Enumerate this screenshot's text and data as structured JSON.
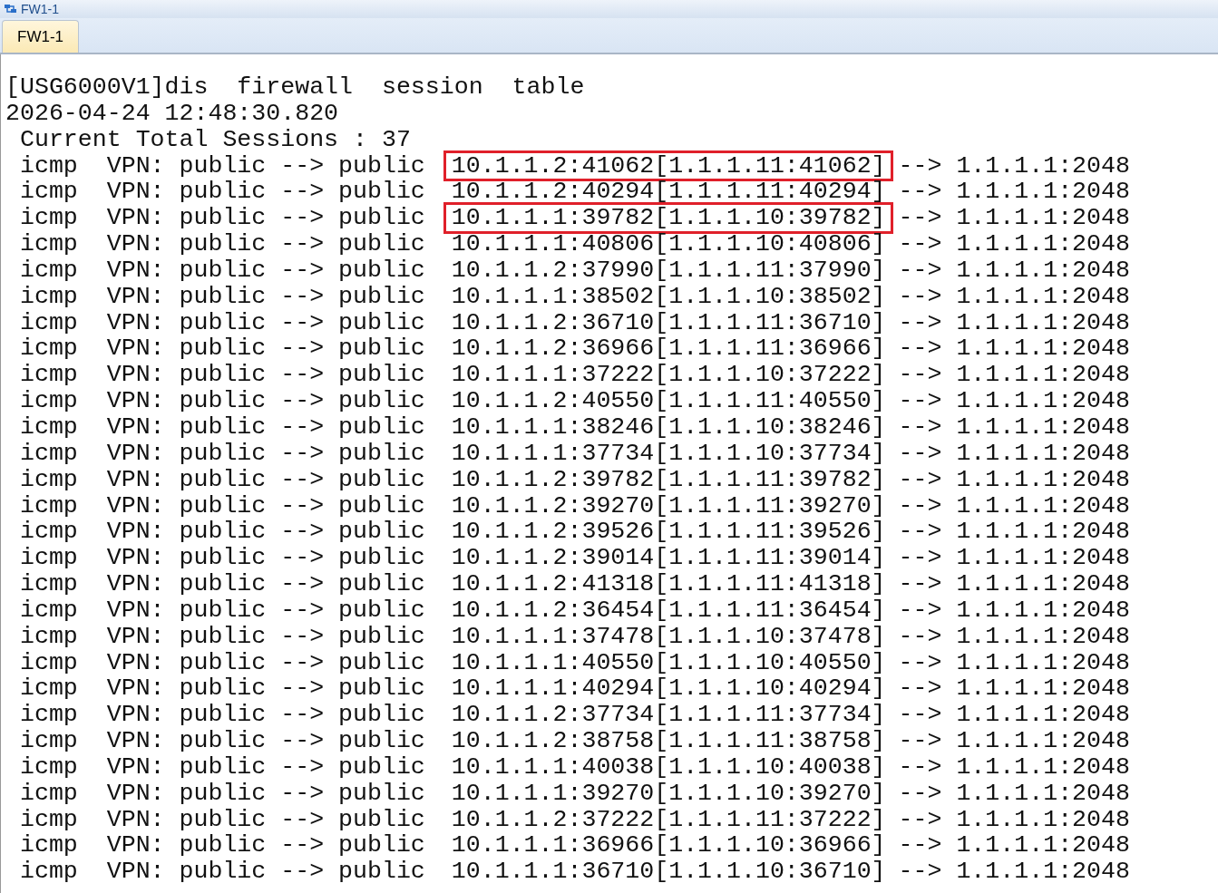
{
  "window": {
    "title": "FW1-1"
  },
  "tabs": [
    {
      "label": "FW1-1",
      "selected": true
    }
  ],
  "terminal": {
    "lines": [
      {
        "kind": "text",
        "text": "[USG6000V1]dis  firewall  session  table"
      },
      {
        "kind": "text",
        "text": "2026-04-24 12:48:30.820"
      },
      {
        "kind": "text",
        "text": " Current Total Sessions : 37"
      },
      {
        "kind": "session",
        "head": " icmp  VPN: public --> public",
        "source": "10.1.1.2:41062[1.1.1.11:41062]",
        "destination": "--> 1.1.1.1:2048",
        "highlighted": true
      },
      {
        "kind": "session",
        "head": " icmp  VPN: public --> public",
        "source": "10.1.1.2:40294[1.1.1.11:40294]",
        "destination": "--> 1.1.1.1:2048",
        "highlighted": false
      },
      {
        "kind": "session",
        "head": " icmp  VPN: public --> public",
        "source": "10.1.1.1:39782[1.1.1.10:39782]",
        "destination": "--> 1.1.1.1:2048",
        "highlighted": true
      },
      {
        "kind": "session",
        "head": " icmp  VPN: public --> public",
        "source": "10.1.1.1:40806[1.1.1.10:40806]",
        "destination": "--> 1.1.1.1:2048",
        "highlighted": false
      },
      {
        "kind": "session",
        "head": " icmp  VPN: public --> public",
        "source": "10.1.1.2:37990[1.1.1.11:37990]",
        "destination": "--> 1.1.1.1:2048",
        "highlighted": false
      },
      {
        "kind": "session",
        "head": " icmp  VPN: public --> public",
        "source": "10.1.1.1:38502[1.1.1.10:38502]",
        "destination": "--> 1.1.1.1:2048",
        "highlighted": false
      },
      {
        "kind": "session",
        "head": " icmp  VPN: public --> public",
        "source": "10.1.1.2:36710[1.1.1.11:36710]",
        "destination": "--> 1.1.1.1:2048",
        "highlighted": false
      },
      {
        "kind": "session",
        "head": " icmp  VPN: public --> public",
        "source": "10.1.1.2:36966[1.1.1.11:36966]",
        "destination": "--> 1.1.1.1:2048",
        "highlighted": false
      },
      {
        "kind": "session",
        "head": " icmp  VPN: public --> public",
        "source": "10.1.1.1:37222[1.1.1.10:37222]",
        "destination": "--> 1.1.1.1:2048",
        "highlighted": false
      },
      {
        "kind": "session",
        "head": " icmp  VPN: public --> public",
        "source": "10.1.1.2:40550[1.1.1.11:40550]",
        "destination": "--> 1.1.1.1:2048",
        "highlighted": false
      },
      {
        "kind": "session",
        "head": " icmp  VPN: public --> public",
        "source": "10.1.1.1:38246[1.1.1.10:38246]",
        "destination": "--> 1.1.1.1:2048",
        "highlighted": false
      },
      {
        "kind": "session",
        "head": " icmp  VPN: public --> public",
        "source": "10.1.1.1:37734[1.1.1.10:37734]",
        "destination": "--> 1.1.1.1:2048",
        "highlighted": false
      },
      {
        "kind": "session",
        "head": " icmp  VPN: public --> public",
        "source": "10.1.1.2:39782[1.1.1.11:39782]",
        "destination": "--> 1.1.1.1:2048",
        "highlighted": false
      },
      {
        "kind": "session",
        "head": " icmp  VPN: public --> public",
        "source": "10.1.1.2:39270[1.1.1.11:39270]",
        "destination": "--> 1.1.1.1:2048",
        "highlighted": false
      },
      {
        "kind": "session",
        "head": " icmp  VPN: public --> public",
        "source": "10.1.1.2:39526[1.1.1.11:39526]",
        "destination": "--> 1.1.1.1:2048",
        "highlighted": false
      },
      {
        "kind": "session",
        "head": " icmp  VPN: public --> public",
        "source": "10.1.1.2:39014[1.1.1.11:39014]",
        "destination": "--> 1.1.1.1:2048",
        "highlighted": false
      },
      {
        "kind": "session",
        "head": " icmp  VPN: public --> public",
        "source": "10.1.1.2:41318[1.1.1.11:41318]",
        "destination": "--> 1.1.1.1:2048",
        "highlighted": false
      },
      {
        "kind": "session",
        "head": " icmp  VPN: public --> public",
        "source": "10.1.1.2:36454[1.1.1.11:36454]",
        "destination": "--> 1.1.1.1:2048",
        "highlighted": false
      },
      {
        "kind": "session",
        "head": " icmp  VPN: public --> public",
        "source": "10.1.1.1:37478[1.1.1.10:37478]",
        "destination": "--> 1.1.1.1:2048",
        "highlighted": false
      },
      {
        "kind": "session",
        "head": " icmp  VPN: public --> public",
        "source": "10.1.1.1:40550[1.1.1.10:40550]",
        "destination": "--> 1.1.1.1:2048",
        "highlighted": false
      },
      {
        "kind": "session",
        "head": " icmp  VPN: public --> public",
        "source": "10.1.1.1:40294[1.1.1.10:40294]",
        "destination": "--> 1.1.1.1:2048",
        "highlighted": false
      },
      {
        "kind": "session",
        "head": " icmp  VPN: public --> public",
        "source": "10.1.1.2:37734[1.1.1.11:37734]",
        "destination": "--> 1.1.1.1:2048",
        "highlighted": false
      },
      {
        "kind": "session",
        "head": " icmp  VPN: public --> public",
        "source": "10.1.1.2:38758[1.1.1.11:38758]",
        "destination": "--> 1.1.1.1:2048",
        "highlighted": false
      },
      {
        "kind": "session",
        "head": " icmp  VPN: public --> public",
        "source": "10.1.1.1:40038[1.1.1.10:40038]",
        "destination": "--> 1.1.1.1:2048",
        "highlighted": false
      },
      {
        "kind": "session",
        "head": " icmp  VPN: public --> public",
        "source": "10.1.1.1:39270[1.1.1.10:39270]",
        "destination": "--> 1.1.1.1:2048",
        "highlighted": false
      },
      {
        "kind": "session",
        "head": " icmp  VPN: public --> public",
        "source": "10.1.1.2:37222[1.1.1.11:37222]",
        "destination": "--> 1.1.1.1:2048",
        "highlighted": false
      },
      {
        "kind": "session",
        "head": " icmp  VPN: public --> public",
        "source": "10.1.1.1:36966[1.1.1.10:36966]",
        "destination": "--> 1.1.1.1:2048",
        "highlighted": false
      },
      {
        "kind": "session",
        "head": " icmp  VPN: public --> public",
        "source": "10.1.1.1:36710[1.1.1.10:36710]",
        "destination": "--> 1.1.1.1:2048",
        "highlighted": false
      }
    ]
  }
}
